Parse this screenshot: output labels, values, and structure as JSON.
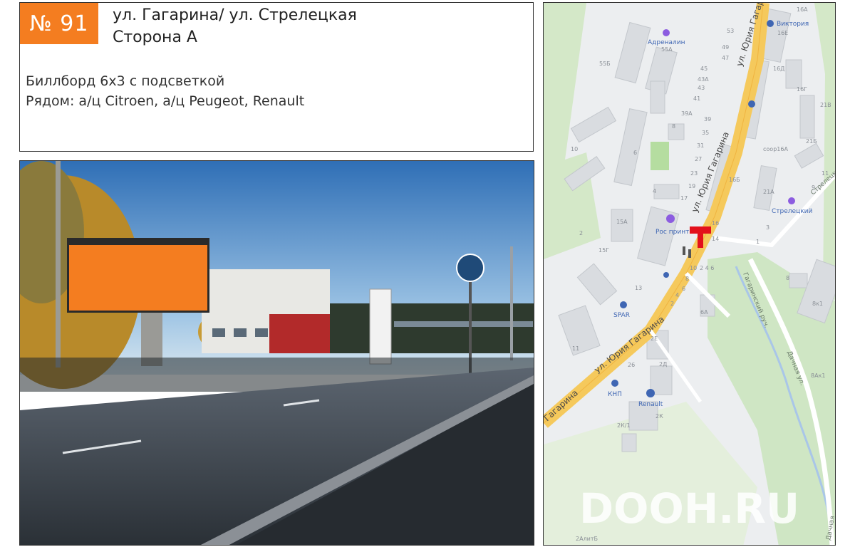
{
  "card": {
    "number": "№ 91",
    "address_line1": "ул. Гагарина/ ул. Стрелецкая",
    "address_line2": "Сторона А",
    "description_line1": "Биллборд 6х3 с подсветкой",
    "description_line2": "Рядом: а/ц Citroen, а/ц Peugeot, Renault"
  },
  "colors": {
    "accent": "#f47d20",
    "road": "#f5c95c",
    "marker": "#e3101b"
  },
  "photo": {
    "billboard_color": "#f47d20",
    "alt": "street photo with billboard"
  },
  "map": {
    "streets": {
      "gagarina_top": "ул. Юрия Гагарина",
      "gagarina_mid": "ул. Юрия Гагарина",
      "gagarina_bottom": "Гагарина",
      "strelets": "Стрелецк",
      "gagarinskiy": "Гагаринский руч.",
      "dachnaya": "Дачная ул.",
      "dachnaya2": "Дачная"
    },
    "pois": {
      "adrenalin": "Адреналин",
      "viktoria": "Виктория",
      "rosprint": "Рос принт",
      "streletsky": "Стрелецкий",
      "spar": "SPAR",
      "knp": "КНП",
      "renault": "Renault"
    },
    "buildings": {
      "b16a": "16А",
      "b16e": "16Е",
      "b16d": "16Д",
      "b16g": "16Г",
      "b53": "53",
      "b49": "49",
      "b47": "47",
      "b55b": "55Б",
      "b55a": "55А",
      "b45": "45",
      "b43a": "43А",
      "b43": "43",
      "b41": "41",
      "b21v": "21В",
      "b39a": "39А",
      "b39": "39",
      "b8": "8",
      "b35": "35",
      "b31": "31",
      "b21b": "21Б",
      "b10": "10",
      "b6": "6",
      "b27": "27",
      "b23": "23",
      "b19": "19",
      "b16b": "16Б",
      "b11": "11",
      "b9": "9",
      "b21a": "21А",
      "b4": "4",
      "b17": "17",
      "b15a": "15А",
      "b2": "2",
      "b16": "16",
      "b14": "14",
      "b3": "3",
      "b1": "1",
      "b15g": "15Г",
      "b10s": "10",
      "b246": "2  4  6",
      "b8b": "8",
      "b6b": "6",
      "b8k1": "8к1",
      "b13": "13",
      "b4b": "4",
      "b2b": "2",
      "b6a": "6А",
      "b11b": "11",
      "b2e": "2Е",
      "b2d": "2Д",
      "b26": "26",
      "b8ak1": "8Ак1",
      "b2k": "2К",
      "b2k1": "2К/1",
      "b2alitb": "2АлитБ",
      "soor16a": "соор16А"
    },
    "watermark": "DOOH.RU"
  }
}
